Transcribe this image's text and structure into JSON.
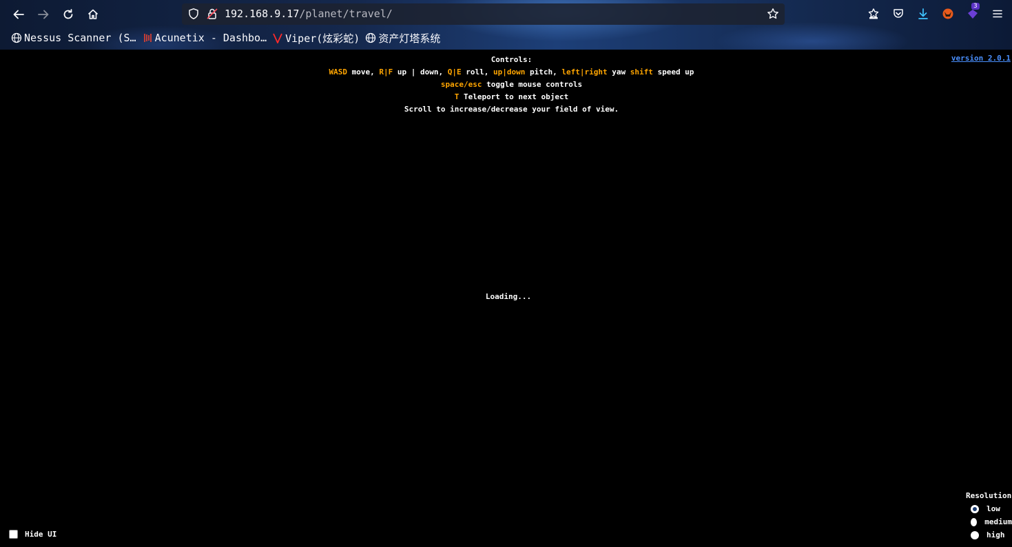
{
  "browser": {
    "url_host": "192.168.9.17",
    "url_path": "/planet/travel/",
    "downloads_badge": "3",
    "bookmarks": [
      {
        "label": "Nessus Scanner (S…",
        "icon": "globe-icon"
      },
      {
        "label": "Acunetix - Dashbo…",
        "icon": "acunetix-icon"
      },
      {
        "label": "Viper(炫彩蛇)",
        "icon": "viper-icon"
      },
      {
        "label": "资产灯塔系统",
        "icon": "globe-icon"
      }
    ]
  },
  "page": {
    "controls": {
      "heading": "Controls:",
      "line1": [
        {
          "t": "WASD",
          "k": true
        },
        {
          "t": " move, ",
          "k": false
        },
        {
          "t": "R|F",
          "k": true
        },
        {
          "t": " up | down, ",
          "k": false
        },
        {
          "t": "Q|E",
          "k": true
        },
        {
          "t": " roll, ",
          "k": false
        },
        {
          "t": "up|down",
          "k": true
        },
        {
          "t": " pitch, ",
          "k": false
        },
        {
          "t": "left|right",
          "k": true
        },
        {
          "t": " yaw ",
          "k": false
        },
        {
          "t": "shift",
          "k": true
        },
        {
          "t": " speed up",
          "k": false
        }
      ],
      "line2_key": "space/esc",
      "line2_text": " toggle mouse controls",
      "line3_key": "T",
      "line3_text": " Teleport to next object",
      "line4": "Scroll to increase/decrease your field of view."
    },
    "version": "version 2.0.1",
    "loading": "Loading...",
    "hide_ui_label": "Hide UI",
    "resolution": {
      "title": "Resolution",
      "options": [
        "low",
        "medium",
        "high"
      ],
      "selected": "low"
    }
  },
  "colors": {
    "key_highlight": "#ffa500",
    "link": "#4a90ff"
  }
}
